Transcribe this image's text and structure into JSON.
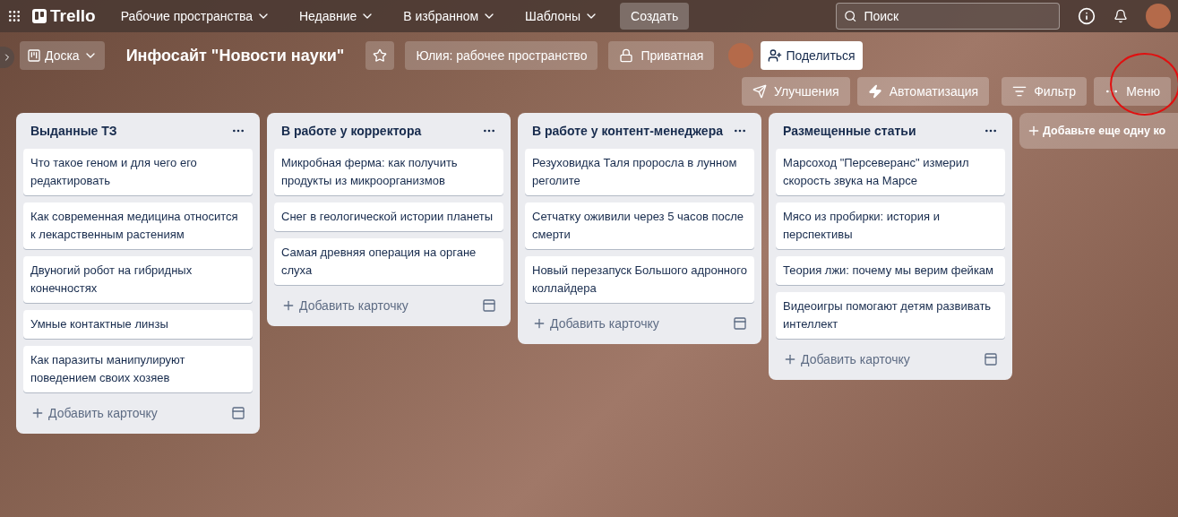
{
  "topbar": {
    "logo": "Trello",
    "menus": [
      {
        "label": "Рабочие пространства"
      },
      {
        "label": "Недавние"
      },
      {
        "label": "В избранном"
      },
      {
        "label": "Шаблоны"
      }
    ],
    "create": "Создать",
    "search": {
      "placeholder": "Поиск"
    }
  },
  "board": {
    "view": "Доска",
    "title": "Инфосайт \"Новости науки\"",
    "workspace": "Юлия: рабочее пространство",
    "visibility": "Приватная",
    "share": "Поделиться",
    "actions": [
      {
        "kind": "powerups",
        "label": "Улучшения"
      },
      {
        "kind": "automation",
        "label": "Автоматизация"
      },
      {
        "kind": "filter",
        "label": "Фильтр"
      },
      {
        "kind": "menu",
        "label": "Меню"
      }
    ]
  },
  "lists": [
    {
      "title": "Выданные ТЗ",
      "cards": [
        "Что такое геном и для чего его редактировать",
        "Как современная медицина относится к лекарственным растениям",
        "Двуногий робот на гибридных конечностях",
        "Умные контактные линзы",
        "Как паразиты манипулируют поведением своих хозяев"
      ],
      "add_card": "Добавить карточку"
    },
    {
      "title": "В работе у корректора",
      "cards": [
        "Микробная ферма: как получить продукты из микроорганизмов",
        "Снег в геологической истории планеты",
        "Самая древняя операция на органе слуха"
      ],
      "add_card": "Добавить карточку"
    },
    {
      "title": "В работе у контент-менеджера",
      "cards": [
        "Резуховидка Таля проросла в лунном реголите",
        "Сетчатку оживили через 5 часов после смерти",
        "Новый перезапуск Большого адронного коллайдера"
      ],
      "add_card": "Добавить карточку"
    },
    {
      "title": "Размещенные статьи",
      "cards": [
        "Марсоход \"Персеверанс\" измерил скорость звука на Марсе",
        "Мясо из пробирки: история и перспективы",
        "Теория лжи: почему мы верим фейкам",
        "Видеоигры помогают детям развивать интеллект"
      ],
      "add_card": "Добавить карточку"
    }
  ],
  "add_list": "Добавьте еще одну ко"
}
